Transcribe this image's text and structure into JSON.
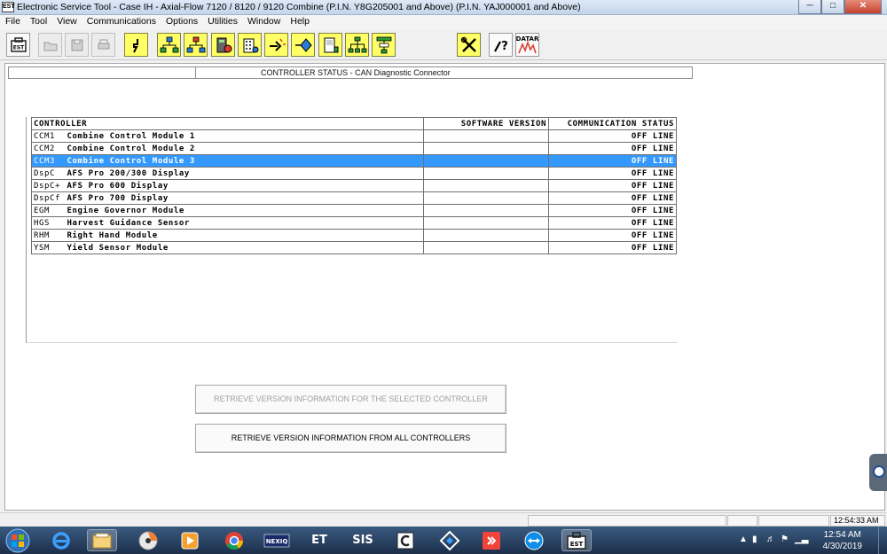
{
  "window": {
    "title": "Electronic Service Tool - Case IH - Axial-Flow 7120 / 8120 / 9120 Combine (P.I.N. Y8G205001 and Above) (P.I.N. YAJ000001 and Above)",
    "app_icon_text": "EST"
  },
  "menu": [
    "File",
    "Tool",
    "View",
    "Communications",
    "Options",
    "Utilities",
    "Window",
    "Help"
  ],
  "toolbar": {
    "icons": [
      "est-logo-icon",
      "open-folder-icon",
      "save-disk-icon",
      "print-icon",
      "connector-icon",
      "network-icon",
      "network-alt-icon",
      "calculator-icon",
      "building-icon",
      "wand-icon",
      "diamond-icon",
      "device-icon",
      "tree-icon",
      "tree-alt-icon",
      "tools-icon",
      "help-question-icon",
      "datar-icon"
    ],
    "est_label": "EST",
    "datar_label": "DATAR"
  },
  "status_header": {
    "title": "CONTROLLER STATUS  -  CAN Diagnostic Connector"
  },
  "table": {
    "headers": {
      "controller": "CONTROLLER",
      "software_version": "SOFTWARE VERSION",
      "communication_status": "COMMUNICATION STATUS"
    },
    "rows": [
      {
        "code": "CCM1",
        "name": "Combine Control Module 1",
        "version": "",
        "status": "OFF LINE"
      },
      {
        "code": "CCM2",
        "name": "Combine Control Module 2",
        "version": "",
        "status": "OFF LINE"
      },
      {
        "code": "CCM3",
        "name": "Combine Control Module 3",
        "version": "",
        "status": "OFF LINE"
      },
      {
        "code": "DspC",
        "name": "AFS Pro 200/300 Display",
        "version": "",
        "status": "OFF LINE"
      },
      {
        "code": "DspC+",
        "name": "AFS Pro 600 Display",
        "version": "",
        "status": "OFF LINE"
      },
      {
        "code": "DspCf",
        "name": "AFS Pro 700 Display",
        "version": "",
        "status": "OFF LINE"
      },
      {
        "code": "EGM",
        "name": "Engine Governor Module",
        "version": "",
        "status": "OFF LINE"
      },
      {
        "code": "HGS",
        "name": "Harvest Guidance Sensor",
        "version": "",
        "status": "OFF LINE"
      },
      {
        "code": "RHM",
        "name": "Right Hand Module",
        "version": "",
        "status": "OFF LINE"
      },
      {
        "code": "YSM",
        "name": "Yield Sensor Module",
        "version": "",
        "status": "OFF LINE"
      }
    ],
    "selected_index": 2
  },
  "buttons": {
    "retrieve_selected": "RETRIEVE VERSION INFORMATION FOR THE SELECTED CONTROLLER",
    "retrieve_all": "RETRIEVE VERSION INFORMATION FROM ALL CONTROLLERS"
  },
  "statusbar": {
    "time": "12:54:33 AM"
  },
  "taskbar": {
    "items": [
      "start-orb-icon",
      "internet-explorer-icon",
      "file-explorer-icon",
      "media-disc-icon",
      "media-player-icon",
      "chrome-icon",
      "nexiq-icon",
      "et-icon",
      "sis-icon",
      "cat-icon",
      "network-app-icon",
      "anydesk-icon",
      "teamviewer-icon",
      "est-taskbar-icon"
    ],
    "nexiq_label": "NEXIQ",
    "et_label": "ET",
    "sis_label": "SIS",
    "est_label": "EST",
    "clock_time": "12:54 AM",
    "clock_date": "4/30/2019"
  }
}
